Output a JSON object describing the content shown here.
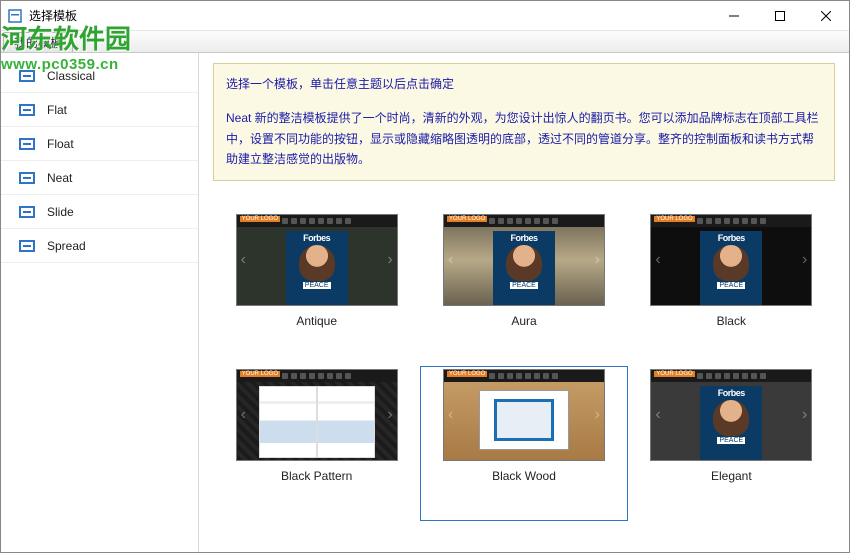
{
  "window": {
    "title": "选择模板"
  },
  "watermark": {
    "line1": "河东软件园",
    "line2": "www.pc0359.cn"
  },
  "tabs": {
    "active": "我的模板"
  },
  "sidebar": {
    "items": [
      {
        "label": "Classical"
      },
      {
        "label": "Flat"
      },
      {
        "label": "Float"
      },
      {
        "label": "Neat"
      },
      {
        "label": "Slide"
      },
      {
        "label": "Spread"
      }
    ]
  },
  "info": {
    "title": "选择一个模板，单击任意主题以后点击确定",
    "body": "Neat 新的整洁模板提供了一个时尚，清新的外观，为您设计出惊人的翻页书。您可以添加品牌标志在顶部工具栏中，设置不同功能的按钮，显示或隐藏缩略图透明的底部，透过不同的管道分享。整齐的控制面板和读书方式帮助建立整洁感觉的出版物。"
  },
  "themes": [
    {
      "label": "Antique",
      "variant": "antique",
      "kind": "mag"
    },
    {
      "label": "Aura",
      "variant": "aura",
      "kind": "mag"
    },
    {
      "label": "Black",
      "variant": "black",
      "kind": "mag"
    },
    {
      "label": "Black Pattern",
      "variant": "pattern",
      "kind": "book"
    },
    {
      "label": "Black Wood",
      "variant": "wood",
      "kind": "screen",
      "selected": true
    },
    {
      "label": "Elegant",
      "variant": "elegant",
      "kind": "mag"
    }
  ],
  "thumb": {
    "logo": "YOUR LOGO",
    "mag_title": "Forbes",
    "mag_tag": "PEACE"
  }
}
